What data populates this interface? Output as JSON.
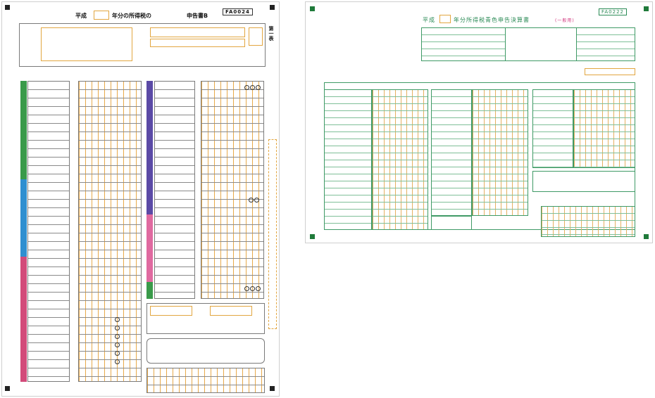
{
  "form_a": {
    "title_prefix": "平成",
    "title_mid": "年分の所得税の",
    "title_form": "申告書B",
    "code": "FA0024",
    "side_label": "第一表",
    "colors": {
      "income": "#3a9a4a",
      "income_band2": "#2f8fd0",
      "deduction": "#d24b7a",
      "tax": "#5b4aa6",
      "tax2": "#e06aa0",
      "other": "#3a9a4a"
    }
  },
  "form_b": {
    "title_prefix": "平成",
    "title_rest": "年分所得税青色申告決算書",
    "subtitle": "(一般用)",
    "code": "FA0222"
  }
}
